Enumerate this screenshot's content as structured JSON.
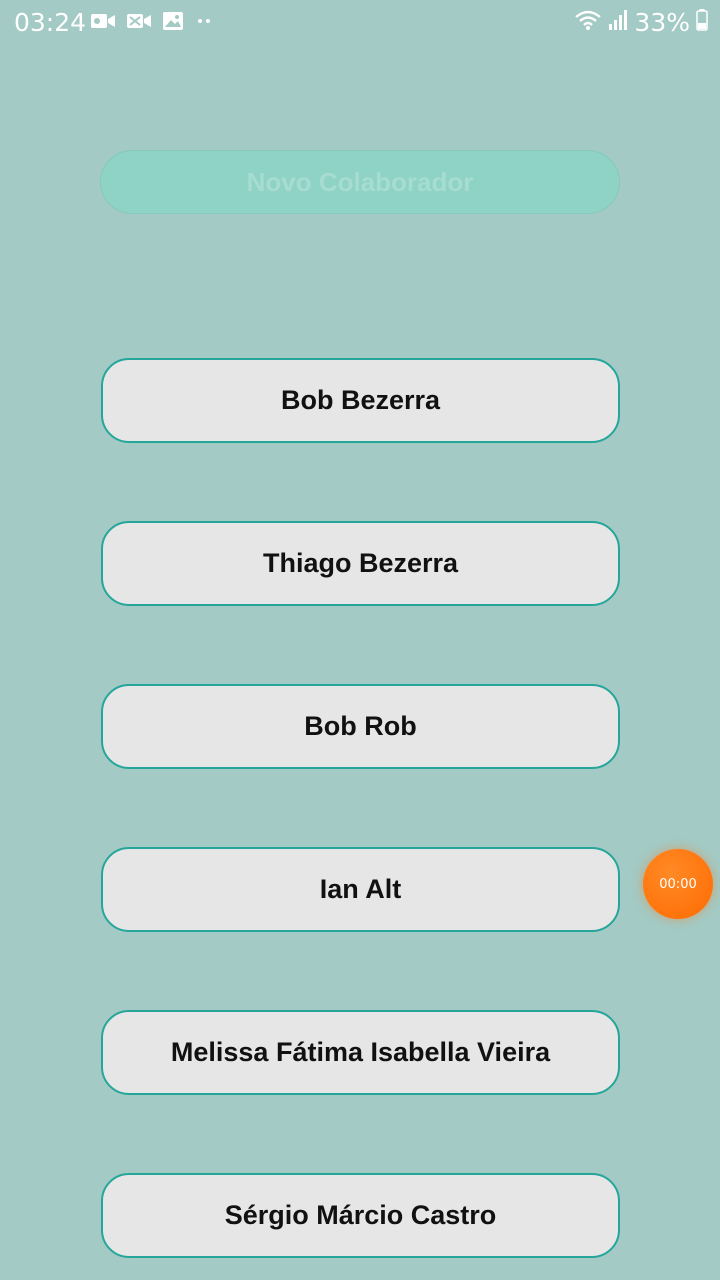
{
  "status_bar": {
    "time": "03:24",
    "battery": "33%",
    "left_icons": [
      "video-camera-icon",
      "video-off-icon",
      "image-icon",
      "dots-icon"
    ],
    "right_icons": [
      "wifi-icon",
      "signal-icon",
      "battery-icon"
    ]
  },
  "new_collaborator_button": {
    "label": "Novo Colaborador"
  },
  "collaborators": [
    {
      "name": "Bob Bezerra"
    },
    {
      "name": "Thiago Bezerra"
    },
    {
      "name": "Bob Rob"
    },
    {
      "name": "Ian Alt"
    },
    {
      "name": "Melissa Fátima Isabella Vieira"
    },
    {
      "name": "Sérgio Márcio Castro"
    }
  ],
  "recording_timer": {
    "time": "00:00"
  },
  "colors": {
    "background": "#a3cac4",
    "accent": "#26a69a",
    "button_fill": "#e6e6e6",
    "timer": "#ff6a00"
  }
}
